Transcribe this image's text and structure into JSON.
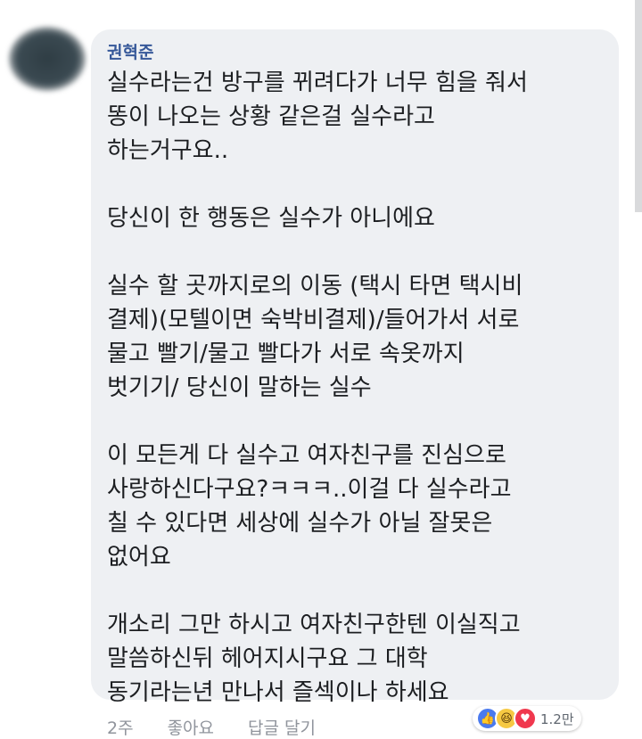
{
  "comment": {
    "author": "권혁준",
    "paragraphs": [
      "실수라는건 방구를 뀌려다가 너무 힘을 줘서\n똥이 나오는 상황 같은걸 실수라고\n하는거구요..",
      "당신이 한 행동은 실수가 아니에요",
      "실수 할 곳까지로의 이동 (택시 타면 택시비\n결제)(모텔이면 숙박비결제)/들어가서 서로\n물고 빨기/물고 빨다가 서로 속옷까지\n벗기기/ 당신이 말하는 실수",
      "이 모든게 다 실수고 여자친구를 진심으로\n사랑하신다구요?ㅋㅋㅋ..이걸 다 실수라고\n칠 수 있다면 세상에 실수가 아닐 잘못은\n없어요",
      "개소리 그만 하시고 여자친구한텐 이실직고\n말씀하신뒤 헤어지시구요 그 대학\n동기라는년 만나서 즐섹이나 하세요"
    ]
  },
  "footer": {
    "time": "2주",
    "like_label": "좋아요",
    "reply_label": "답글 달기"
  },
  "reactions": {
    "icons": [
      "like-icon",
      "haha-icon",
      "love-icon"
    ],
    "count": "1.2만",
    "colors": {
      "like": "#4a7aee",
      "haha": "#f6c943",
      "love": "#f0384e"
    }
  }
}
